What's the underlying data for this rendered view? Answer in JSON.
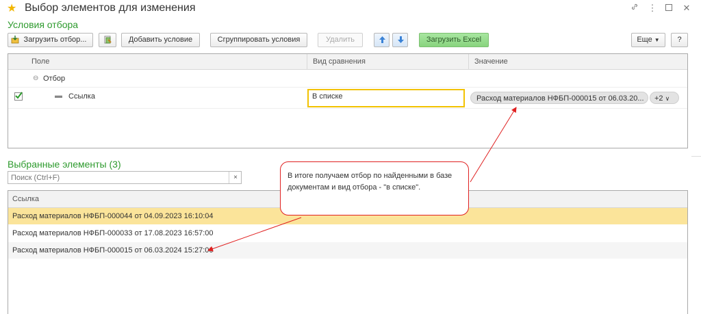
{
  "window": {
    "title": "Выбор элементов для изменения",
    "link_icon": "link-icon",
    "menu_icon": "more-icon",
    "maximize_icon": "maximize-icon",
    "close_icon": "close-icon"
  },
  "conditions": {
    "section_title": "Условия отбора",
    "toolbar": {
      "load_filter": "Загрузить отбор...",
      "add_condition": "Добавить условие",
      "group_conditions": "Сгруппировать условия",
      "delete": "Удалить",
      "load_excel": "Загрузить Excel",
      "more": "Еще",
      "help": "?"
    },
    "columns": [
      "Поле",
      "Вид сравнения",
      "Значение"
    ],
    "rows": [
      {
        "field": "Отбор",
        "comparison": "",
        "value": "",
        "group": true
      },
      {
        "field": "Ссылка",
        "comparison": "В списке",
        "value": "Расход материалов НФБП-000015 от 06.03.20...",
        "extra": "+2",
        "checked": true
      }
    ]
  },
  "selected": {
    "section_title": "Выбранные элементы (3)",
    "search_placeholder": "Поиск (Ctrl+F)",
    "clear_symbol": "×",
    "column": "Ссылка",
    "rows": [
      "Расход материалов НФБП-000044 от 04.09.2023 16:10:04",
      "Расход материалов НФБП-000033 от 17.08.2023 16:57:00",
      "Расход материалов НФБП-000015 от 06.03.2024 15:27:00"
    ]
  },
  "annotation": {
    "text": "В итоге получаем отбор по найденными в базе документам и вид отбора - \"в списке\".",
    "color": "#e02020"
  },
  "colors": {
    "accent_green": "#2d9a2d",
    "selected_row": "#fbe49a",
    "focus_border": "#f2c200"
  }
}
